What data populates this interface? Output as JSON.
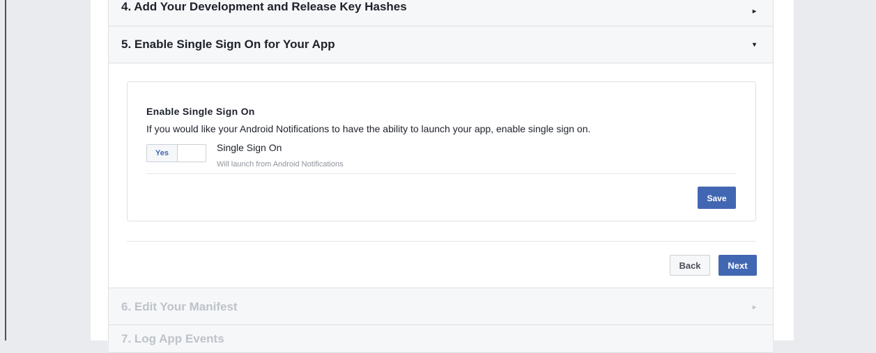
{
  "steps": {
    "step4": {
      "label": "4. Add Your Development and Release Key Hashes",
      "arrow": "▸"
    },
    "step5": {
      "label": "5. Enable Single Sign On for Your App",
      "arrow": "▾"
    },
    "step6": {
      "label": "6. Edit Your Manifest",
      "arrow": "▸"
    },
    "step7": {
      "label": "7. Log App Events"
    }
  },
  "sso": {
    "title": "Enable Single Sign On",
    "description": "If you would like your Android Notifications to have the ability to launch your app, enable single sign on.",
    "toggle_on_label": "Yes",
    "setting_label": "Single Sign On",
    "setting_sublabel": "Will launch from Android Notifications",
    "save_label": "Save"
  },
  "nav": {
    "back_label": "Back",
    "next_label": "Next"
  },
  "colors": {
    "primary": "#4267b2",
    "muted_text": "#bec2c9",
    "header_bg": "#f6f7f9"
  }
}
